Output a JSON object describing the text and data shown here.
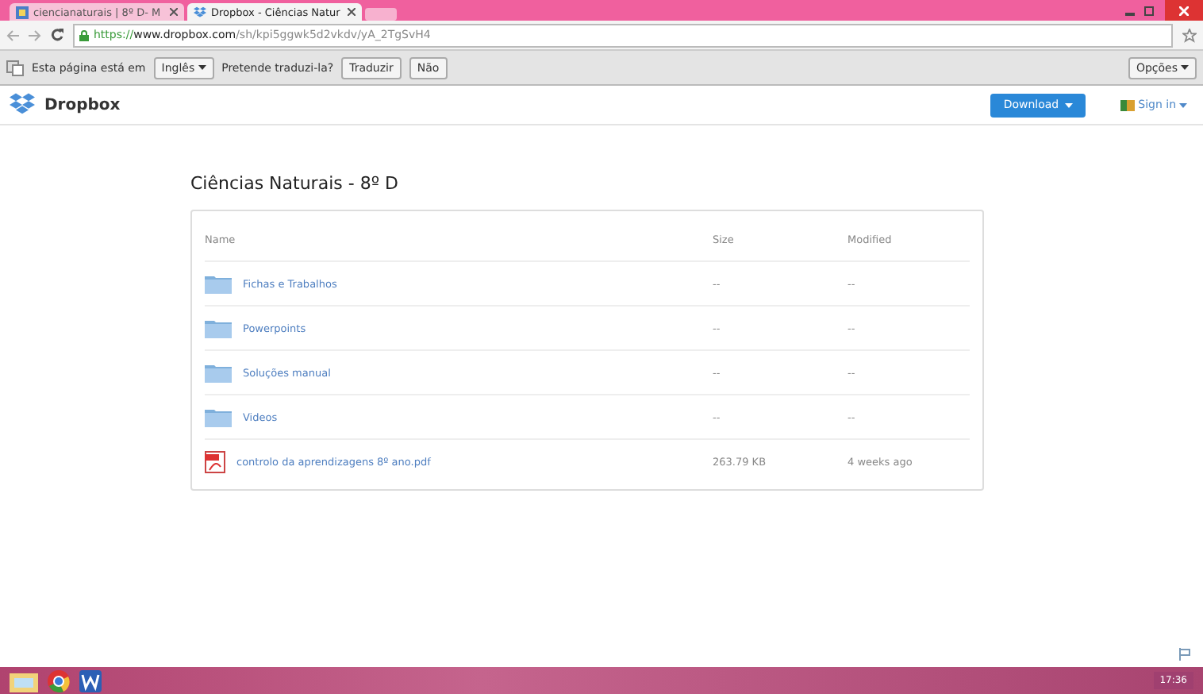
{
  "browser": {
    "tabs": [
      {
        "label": "ciencianaturais | 8º D- M",
        "selected": false,
        "kind": "site"
      },
      {
        "label": "Dropbox - Ciências Natur",
        "selected": true,
        "kind": "dropbox"
      }
    ],
    "url": {
      "scheme": "https://",
      "domain": "www.dropbox.com",
      "path": "/sh/kpi5ggwk5d2vkdv/yA_2TgSvH4"
    }
  },
  "translate_bar": {
    "prefix": "Esta página está em",
    "language": "Inglês",
    "question": "Pretende traduzi-la?",
    "buttons": [
      "Traduzir",
      "Não"
    ],
    "options": "Opções"
  },
  "header": {
    "logo": "Dropbox",
    "download": "Download",
    "sign_in": "Sign in"
  },
  "folder_title": "Ciências Naturais - 8º D",
  "table": {
    "columns": [
      "Name",
      "Size",
      "Modified"
    ],
    "rows": [
      {
        "kind": "folder",
        "name": "Fichas e Trabalhos",
        "size": "--",
        "modified": "--"
      },
      {
        "kind": "folder",
        "name": "Powerpoints",
        "size": "--",
        "modified": "--"
      },
      {
        "kind": "folder",
        "name": "Soluções manual",
        "size": "--",
        "modified": "--"
      },
      {
        "kind": "folder",
        "name": "Videos",
        "size": "--",
        "modified": "--"
      },
      {
        "kind": "pdf",
        "name": "controlo da aprendizagens 8º ano.pdf",
        "size": "263.79 KB",
        "modified": "4 weeks ago"
      }
    ]
  },
  "taskbar": {
    "clock": "17:36"
  }
}
